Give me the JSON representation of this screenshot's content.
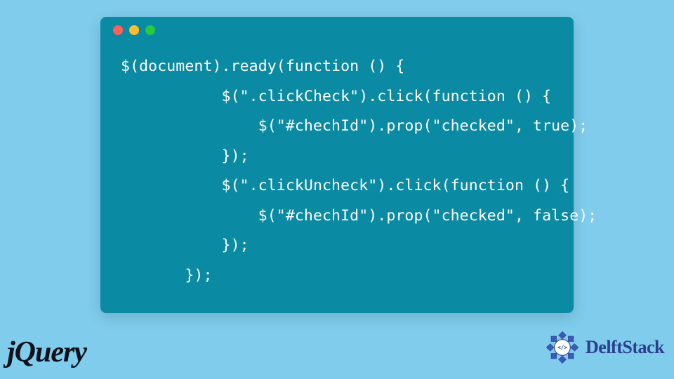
{
  "window": {
    "dots": [
      "red",
      "yellow",
      "green"
    ]
  },
  "code": {
    "line1": " $(document).ready(function () {",
    "line2": "            $(\".clickCheck\").click(function () {",
    "line3": "                $(\"#chechId\").prop(\"checked\", true);",
    "line4": "            });",
    "line5": "            $(\".clickUncheck\").click(function () {",
    "line6": "                $(\"#chechId\").prop(\"checked\", false);",
    "line7": "            });",
    "line8": "        });"
  },
  "logos": {
    "jquery": "jQuery",
    "delftstack": "DelftStack"
  }
}
